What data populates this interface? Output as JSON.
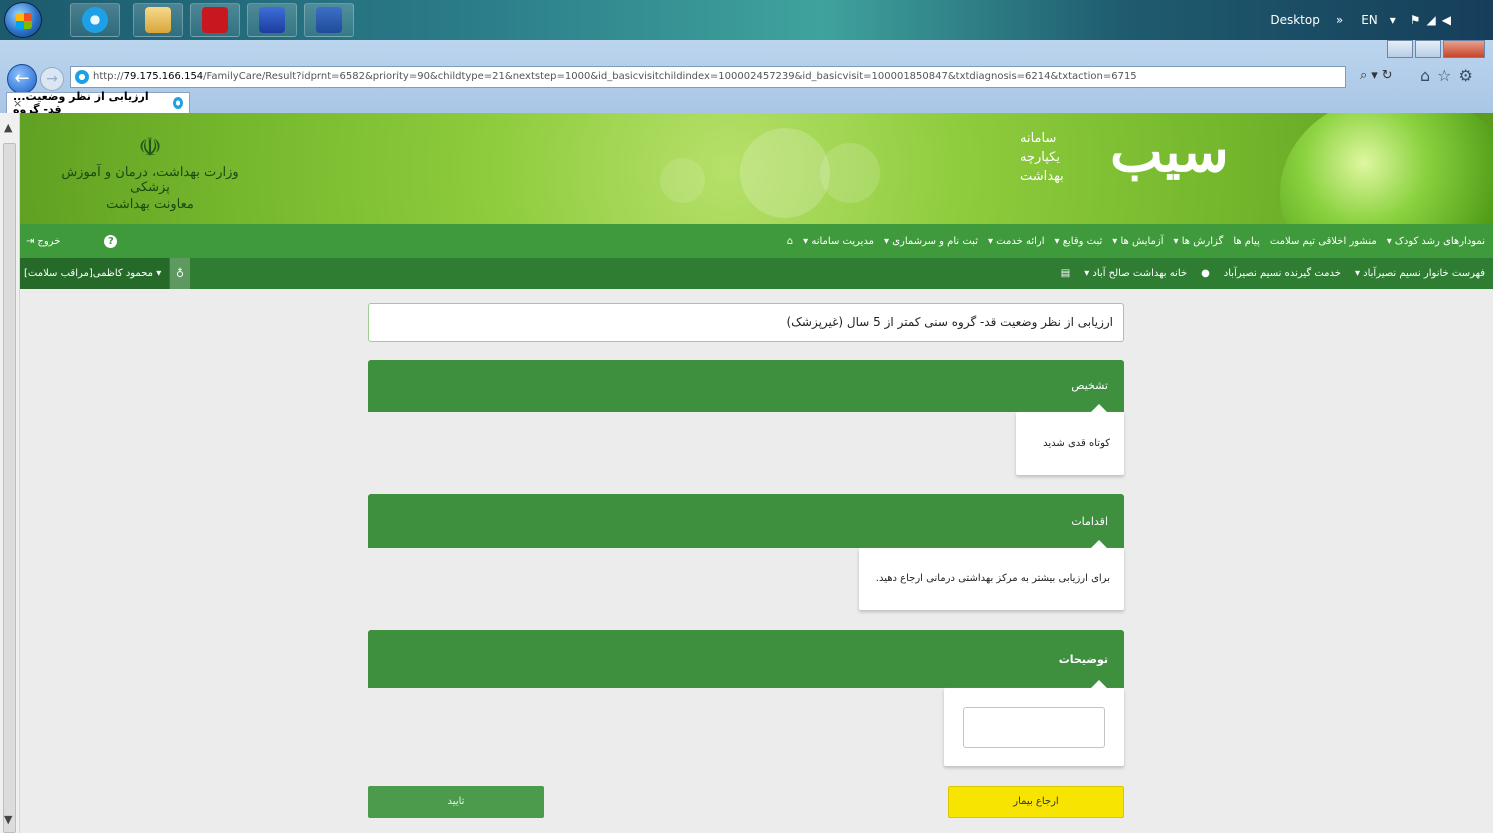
{
  "taskbar": {
    "desktop_label": "Desktop",
    "language": "EN",
    "apps": [
      "start",
      "internet-explorer",
      "file-explorer",
      "acrobat",
      "media-player",
      "word"
    ]
  },
  "browser": {
    "url_prefix": "http://",
    "url_host": "79.175.166.154",
    "url_path": "/FamilyCare/Result?idprnt=6582&priority=90&childtype=21&nextstep=1000&id_basicvisitchildindex=100002457239&id_basicvisit=100001850847&txtdiagnosis=6214&txtaction=6715",
    "tab_title": "...ارزیابی از نظر وضعیت قد- گروه",
    "tab_close": "×"
  },
  "banner": {
    "ministry_line1": "وزارت بهداشت، درمان و آموزش پزشکی",
    "ministry_line2": "معاونت بهداشت",
    "brand_big": "سیب",
    "brand_small1": "سامانه",
    "brand_small2": "یکپارچه",
    "brand_small3": "بهداشت"
  },
  "menu": {
    "items": [
      "مدیریت سامانه ▾",
      "ثبت نام و سرشماری ▾",
      "ارائه خدمت ▾",
      "ثبت وقایع ▾",
      "آزمایش ها ▾",
      "گزارش ها ▾",
      "پیام ها",
      "منشور اخلاقی تیم سلامت",
      "نمودارهای رشد کودک ▾"
    ],
    "exit_label": "خروج",
    "help_label": "?"
  },
  "submenu": {
    "items": [
      "خانه بهداشت صالح آباد ▾",
      "خدمت گیرنده نسیم نصیرآباد",
      "فهرست خانوار نسیم نصیرآباد ▾"
    ],
    "user_label": "محمود کاظمی[مراقب سلامت] ▾"
  },
  "form": {
    "title": "ارزیابی از نظر وضعیت قد- گروه سنی کمتر از 5 سال (غیرپزشک)",
    "diagnosis_header": "تشخیص",
    "diagnosis_value": "کوتاه قدی شدید",
    "actions_header": "اقدامات",
    "actions_value": "برای ارزیابی بیشتر به مرکز بهداشتی درمانی ارجاع دهید.",
    "description_header": "توضیحات",
    "description_value": "",
    "refer_button": "ارجاع بیمار",
    "confirm_button": "تایید"
  }
}
